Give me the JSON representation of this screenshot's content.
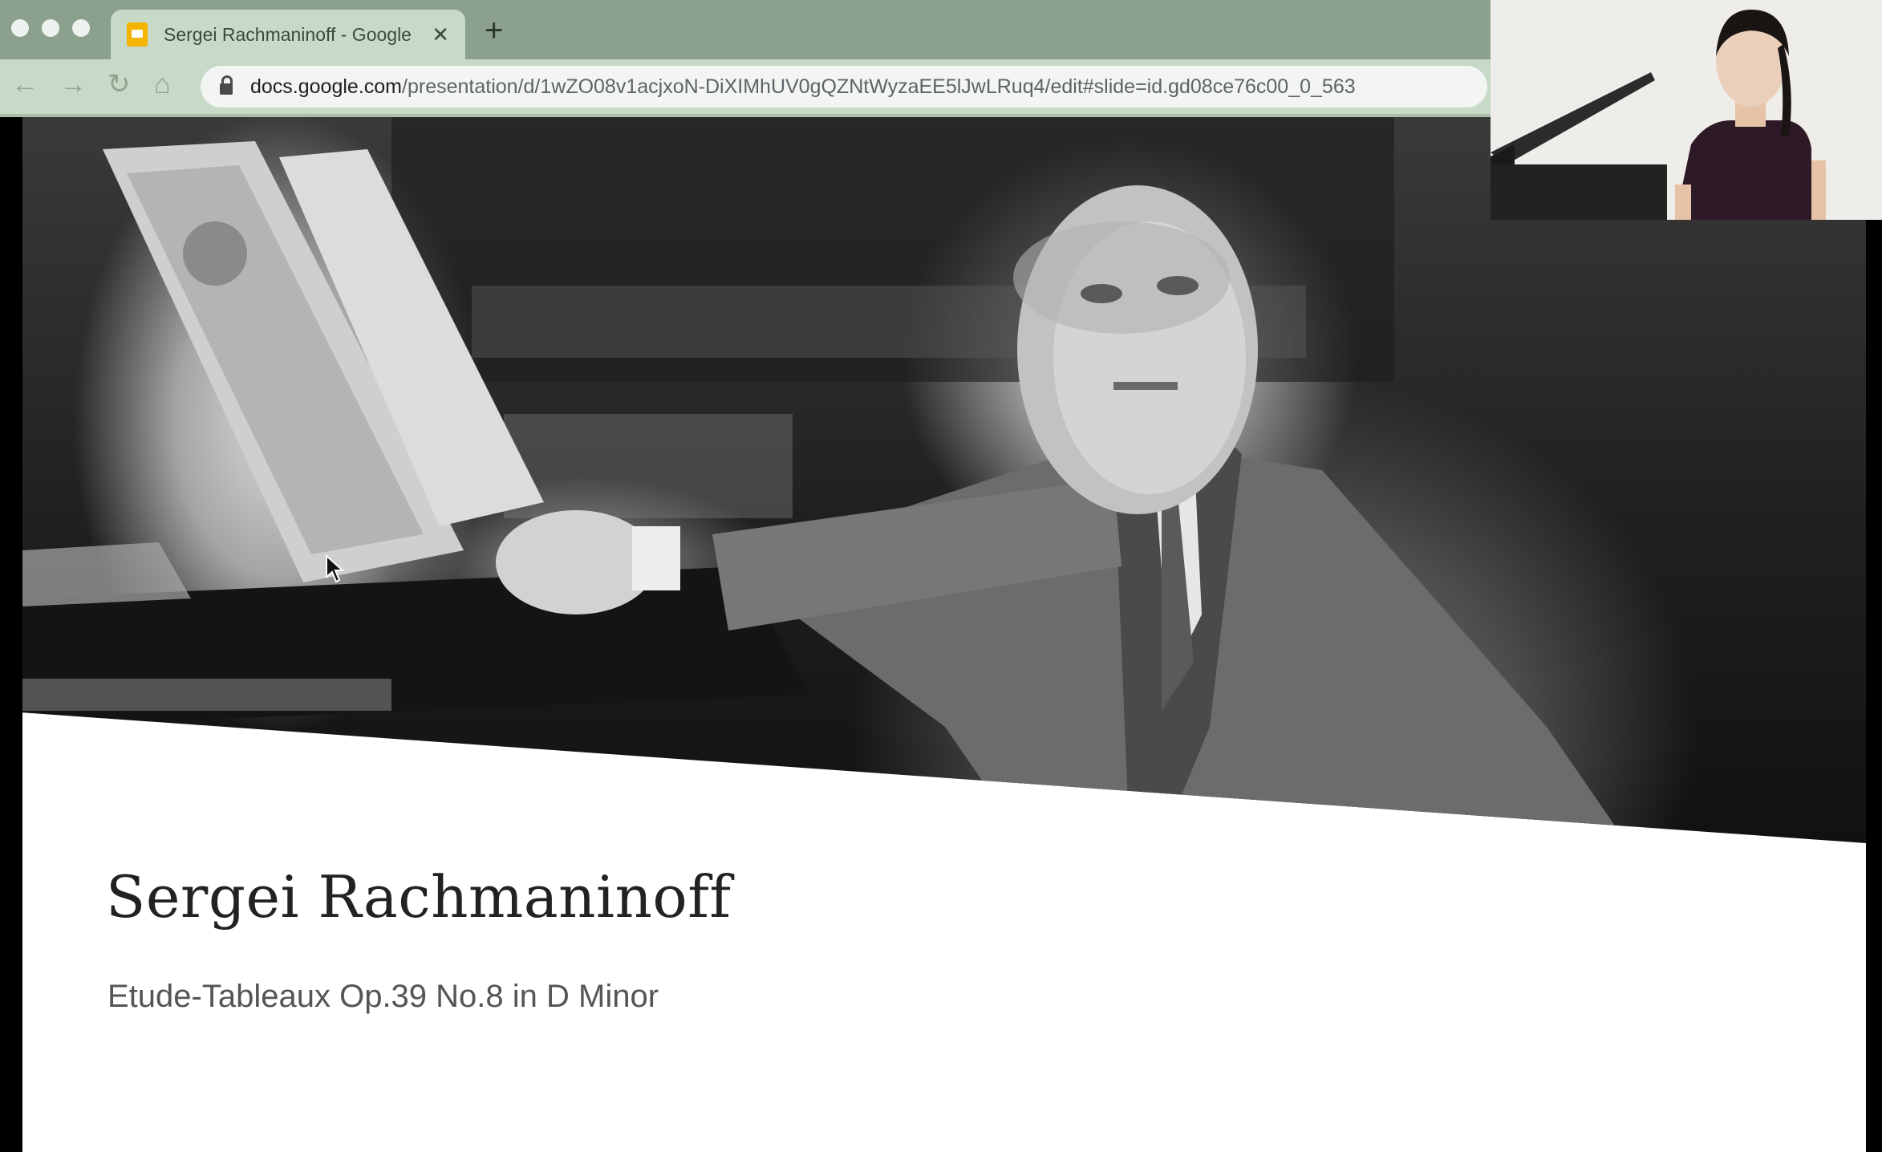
{
  "browser": {
    "tab": {
      "title": "Sergei Rachmaninoff - Google",
      "close_glyph": "✕",
      "favicon": "google-slides-icon"
    },
    "new_tab_glyph": "+",
    "nav": {
      "back": "←",
      "forward": "→",
      "reload": "↻",
      "home": "⌂"
    },
    "address": {
      "host": "docs.google.com",
      "path": "/presentation/d/1wZO08v1acjxoN-DiXIMhUV0gQZNtWyzaEE5lJwLRuq4/edit#slide=id.gd08ce76c00_0_563"
    },
    "colors": {
      "tabbar": "#8ba08d",
      "toolbar": "#c7d9c7"
    }
  },
  "slide": {
    "title": "Sergei Rachmaninoff",
    "subtitle": "Etude-Tableaux Op.39 No.8 in D Minor",
    "photo": "black-and-white photo of the composer seated at a piano"
  },
  "webcam": {
    "content": "presenter video feed"
  }
}
